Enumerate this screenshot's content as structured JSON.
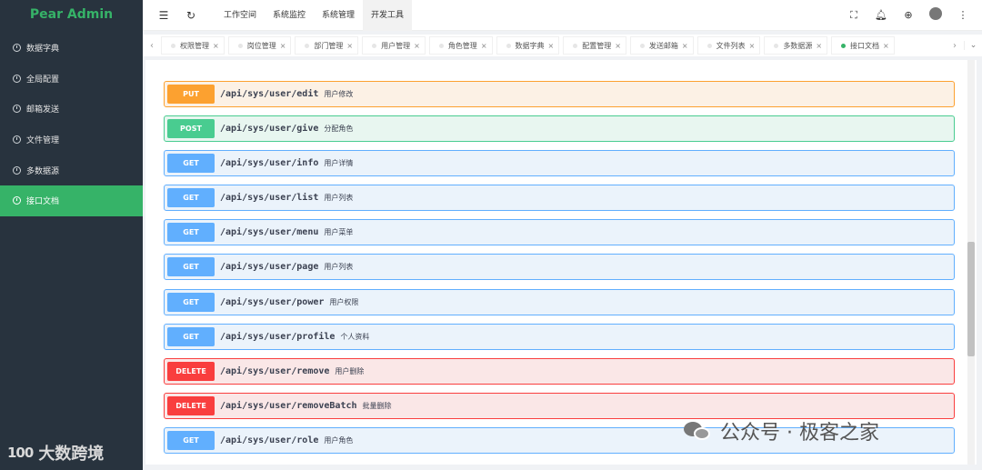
{
  "app": {
    "title": "Pear Admin"
  },
  "sidebar": {
    "items": [
      {
        "label": "数据字典",
        "active": false
      },
      {
        "label": "全局配置",
        "active": false
      },
      {
        "label": "邮箱发送",
        "active": false
      },
      {
        "label": "文件管理",
        "active": false
      },
      {
        "label": "多数据源",
        "active": false
      },
      {
        "label": "接口文档",
        "active": true
      }
    ],
    "brand": "大数跨境",
    "brand_mark": "100"
  },
  "header": {
    "nav": [
      {
        "label": "工作空间",
        "active": false
      },
      {
        "label": "系统监控",
        "active": false
      },
      {
        "label": "系统管理",
        "active": false
      },
      {
        "label": "开发工具",
        "active": true
      }
    ],
    "icons": [
      "menu-fold-icon",
      "refresh-icon",
      "fullscreen-icon",
      "bell-icon",
      "globe-icon",
      "avatar",
      "more-icon"
    ]
  },
  "tabs": [
    {
      "label": "权限管理",
      "active": false
    },
    {
      "label": "岗位管理",
      "active": false
    },
    {
      "label": "部门管理",
      "active": false
    },
    {
      "label": "用户管理",
      "active": false
    },
    {
      "label": "角色管理",
      "active": false
    },
    {
      "label": "数据字典",
      "active": false
    },
    {
      "label": "配置管理",
      "active": false
    },
    {
      "label": "发送邮箱",
      "active": false
    },
    {
      "label": "文件列表",
      "active": false
    },
    {
      "label": "多数据源",
      "active": false
    },
    {
      "label": "接口文档",
      "active": true
    }
  ],
  "operations": [
    {
      "method": "PUT",
      "path": "/api/sys/user/edit",
      "desc": "用户修改"
    },
    {
      "method": "POST",
      "path": "/api/sys/user/give",
      "desc": "分配角色"
    },
    {
      "method": "GET",
      "path": "/api/sys/user/info",
      "desc": "用户详情"
    },
    {
      "method": "GET",
      "path": "/api/sys/user/list",
      "desc": "用户列表"
    },
    {
      "method": "GET",
      "path": "/api/sys/user/menu",
      "desc": "用户菜单"
    },
    {
      "method": "GET",
      "path": "/api/sys/user/page",
      "desc": "用户列表"
    },
    {
      "method": "GET",
      "path": "/api/sys/user/power",
      "desc": "用户权限"
    },
    {
      "method": "GET",
      "path": "/api/sys/user/profile",
      "desc": "个人资料"
    },
    {
      "method": "DELETE",
      "path": "/api/sys/user/remove",
      "desc": "用户删除"
    },
    {
      "method": "DELETE",
      "path": "/api/sys/user/removeBatch",
      "desc": "批量删除"
    },
    {
      "method": "GET",
      "path": "/api/sys/user/role",
      "desc": "用户角色"
    }
  ],
  "watermark": {
    "text": "公众号 · 极客之家"
  },
  "colors": {
    "accent": "#36b368",
    "sidebar_bg": "#28333e",
    "put": "#fca130",
    "post": "#49cc90",
    "get": "#61affe",
    "delete": "#f93e3e"
  }
}
